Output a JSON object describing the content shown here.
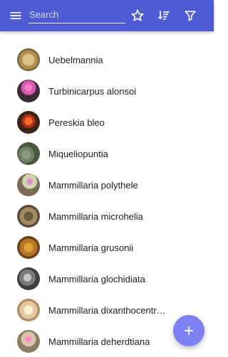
{
  "header": {
    "search_placeholder": "Search",
    "background_color": "#4f5bd5",
    "icons": {
      "menu": "menu-icon",
      "favorite": "star-icon",
      "sort": "sort-icon",
      "filter": "filter-icon"
    }
  },
  "list": {
    "items": [
      {
        "label": "Uebelmannia",
        "avatar_icon": "cactus-photo-icon"
      },
      {
        "label": "Turbinicarpus alonsoi",
        "avatar_icon": "cactus-photo-icon"
      },
      {
        "label": "Pereskia bleo",
        "avatar_icon": "cactus-photo-icon"
      },
      {
        "label": "Miqueliopuntia",
        "avatar_icon": "cactus-photo-icon"
      },
      {
        "label": "Mammillaria polythele",
        "avatar_icon": "cactus-photo-icon"
      },
      {
        "label": "Mammillaria microhelia",
        "avatar_icon": "cactus-photo-icon"
      },
      {
        "label": "Mammillaria grusonii",
        "avatar_icon": "cactus-photo-icon"
      },
      {
        "label": "Mammillaria glochidiata",
        "avatar_icon": "cactus-photo-icon"
      },
      {
        "label": "Mammillaria dixanthocentr…",
        "avatar_icon": "cactus-photo-icon"
      },
      {
        "label": "Mammillaria deherdtiana",
        "avatar_icon": "cactus-photo-icon"
      }
    ]
  },
  "fab": {
    "icon": "plus-icon",
    "color": "#7c80f3"
  }
}
